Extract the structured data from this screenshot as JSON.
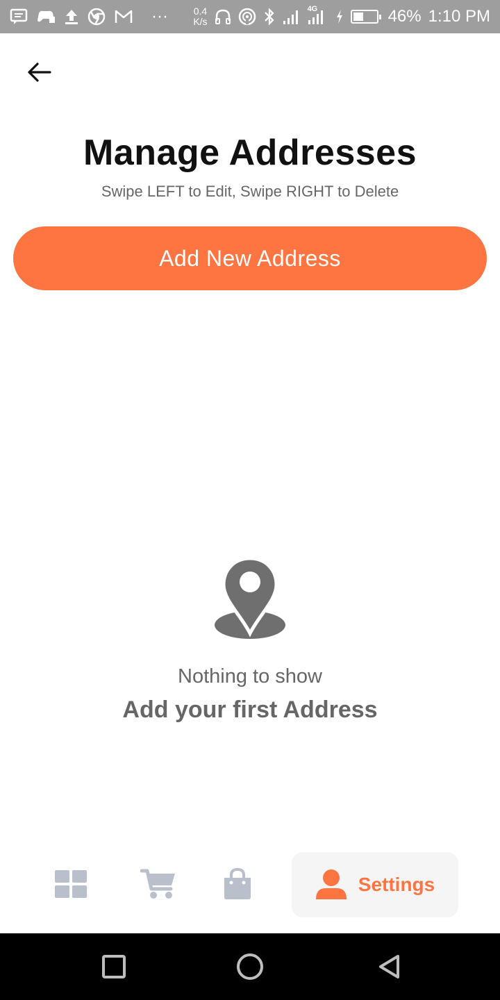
{
  "status_bar": {
    "network_speed_value": "0.4",
    "network_speed_unit": "K/s",
    "network_type": "4G",
    "battery_percent": "46%",
    "battery_level": 0.46,
    "time": "1:10 PM",
    "overflow": "···",
    "icons": [
      "message-icon",
      "game-controller-icon",
      "upload-icon",
      "chrome-icon",
      "gmail-icon",
      "headphones-icon",
      "hotspot-icon",
      "bluetooth-icon",
      "signal-icon",
      "signal-4g-icon",
      "charging-icon",
      "battery-icon"
    ]
  },
  "header": {
    "title": "Manage Addresses",
    "subtitle": "Swipe LEFT to Edit, Swipe RIGHT to Delete"
  },
  "actions": {
    "add_button_label": "Add New Address"
  },
  "empty_state": {
    "icon": "location-pin-icon",
    "line1": "Nothing to show",
    "line2": "Add your first Address"
  },
  "tab_bar": {
    "tabs": [
      {
        "icon": "grid-icon",
        "active": false
      },
      {
        "icon": "cart-icon",
        "active": false
      },
      {
        "icon": "shopping-bag-icon",
        "active": false
      },
      {
        "icon": "person-icon",
        "label": "Settings",
        "active": true
      }
    ]
  },
  "colors": {
    "accent": "#ff7542",
    "inactive_icon": "#b9c0cc",
    "muted_text": "#666666",
    "status_bar": "#9e9e9e"
  }
}
